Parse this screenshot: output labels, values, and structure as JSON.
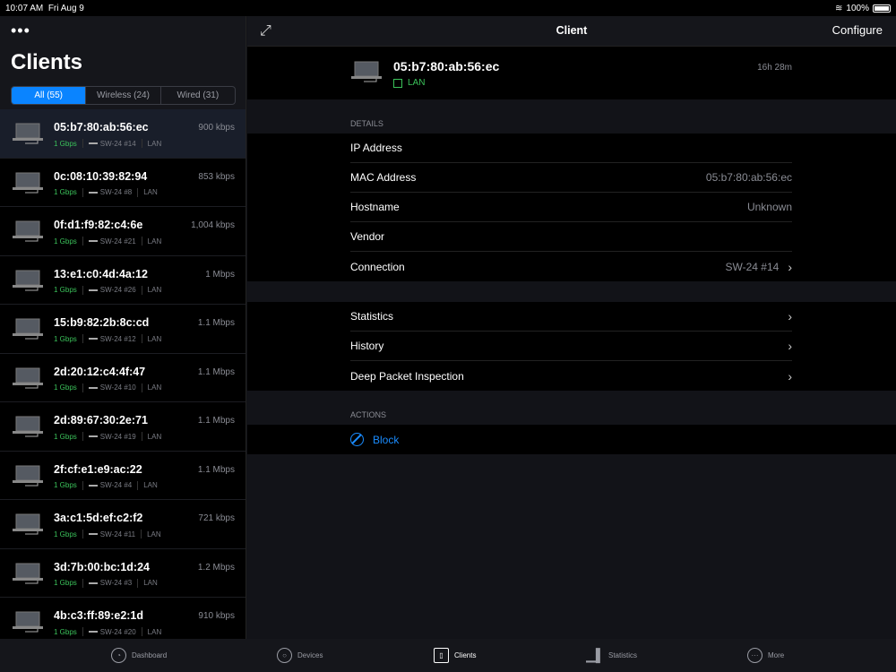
{
  "status": {
    "time": "10:07 AM",
    "date": "Fri Aug 9",
    "battery": "100%"
  },
  "left": {
    "menu": "•••",
    "title": "Clients",
    "segments": [
      "All (55)",
      "Wireless (24)",
      "Wired (31)"
    ],
    "clients": [
      {
        "mac": "05:b7:80:ab:56:ec",
        "rate": "900 kbps",
        "speed": "1 Gbps",
        "port": "SW-24 #14",
        "net": "LAN"
      },
      {
        "mac": "0c:08:10:39:82:94",
        "rate": "853 kbps",
        "speed": "1 Gbps",
        "port": "SW-24 #8",
        "net": "LAN"
      },
      {
        "mac": "0f:d1:f9:82:c4:6e",
        "rate": "1,004 kbps",
        "speed": "1 Gbps",
        "port": "SW-24 #21",
        "net": "LAN"
      },
      {
        "mac": "13:e1:c0:4d:4a:12",
        "rate": "1 Mbps",
        "speed": "1 Gbps",
        "port": "SW-24 #26",
        "net": "LAN"
      },
      {
        "mac": "15:b9:82:2b:8c:cd",
        "rate": "1.1 Mbps",
        "speed": "1 Gbps",
        "port": "SW-24 #12",
        "net": "LAN"
      },
      {
        "mac": "2d:20:12:c4:4f:47",
        "rate": "1.1 Mbps",
        "speed": "1 Gbps",
        "port": "SW-24 #10",
        "net": "LAN"
      },
      {
        "mac": "2d:89:67:30:2e:71",
        "rate": "1.1 Mbps",
        "speed": "1 Gbps",
        "port": "SW-24 #19",
        "net": "LAN"
      },
      {
        "mac": "2f:cf:e1:e9:ac:22",
        "rate": "1.1 Mbps",
        "speed": "1 Gbps",
        "port": "SW-24 #4",
        "net": "LAN"
      },
      {
        "mac": "3a:c1:5d:ef:c2:f2",
        "rate": "721 kbps",
        "speed": "1 Gbps",
        "port": "SW-24 #11",
        "net": "LAN"
      },
      {
        "mac": "3d:7b:00:bc:1d:24",
        "rate": "1.2 Mbps",
        "speed": "1 Gbps",
        "port": "SW-24 #3",
        "net": "LAN"
      },
      {
        "mac": "4b:c3:ff:89:e2:1d",
        "rate": "910 kbps",
        "speed": "1 Gbps",
        "port": "SW-24 #20",
        "net": "LAN"
      }
    ]
  },
  "right": {
    "title": "Client",
    "configure": "Configure",
    "client": {
      "mac": "05:b7:80:ab:56:ec",
      "net": "LAN",
      "uptime": "16h 28m"
    },
    "details_label": "DETAILS",
    "details": [
      {
        "label": "IP Address",
        "value": ""
      },
      {
        "label": "MAC Address",
        "value": "05:b7:80:ab:56:ec"
      },
      {
        "label": "Hostname",
        "value": "Unknown"
      },
      {
        "label": "Vendor",
        "value": ""
      },
      {
        "label": "Connection",
        "value": "SW-24 #14"
      }
    ],
    "links": [
      "Statistics",
      "History",
      "Deep Packet Inspection"
    ],
    "actions_label": "ACTIONS",
    "block": "Block"
  },
  "tabs": [
    "Dashboard",
    "Devices",
    "Clients",
    "Statistics",
    "More"
  ]
}
